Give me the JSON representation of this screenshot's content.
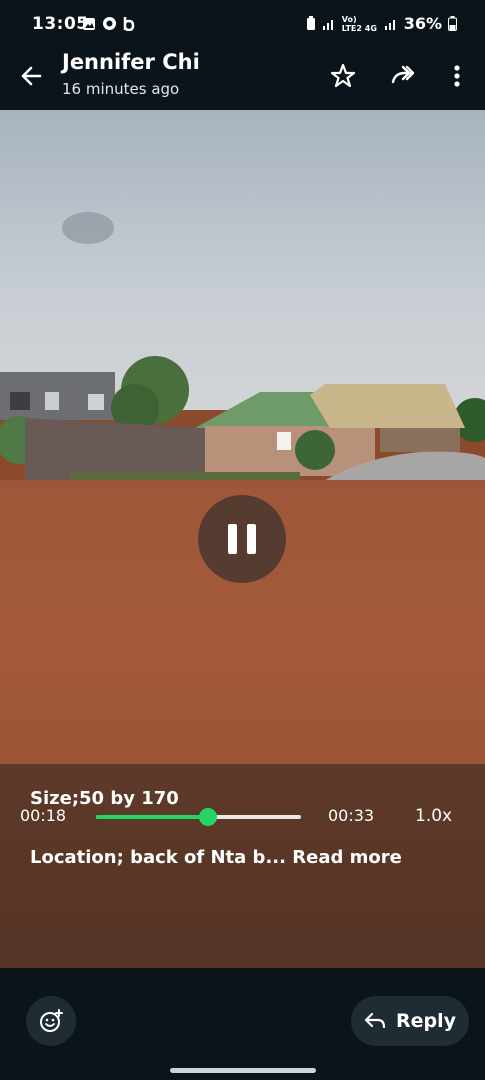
{
  "status": {
    "time": "13:05",
    "network": "Vo) LTE2 4G",
    "battery": "36%"
  },
  "header": {
    "name": "Jennifer Chi",
    "subtitle": "16 minutes ago",
    "icons": [
      "back-arrow-icon",
      "star-icon",
      "forward-icon",
      "more-vertical-icon"
    ]
  },
  "video": {
    "caption_line1": "Size;50 by 170",
    "caption_line2": "Location;  back of Nta b...",
    "read_more": "Read more",
    "current_time": "00:18",
    "total_time": "00:33",
    "speed": "1.0x",
    "progress": 0.545,
    "state": "playing"
  },
  "footer": {
    "reply_label": "Reply"
  },
  "colors": {
    "accent": "#25d366",
    "background": "#0b141a",
    "button": "#1f2c33"
  }
}
